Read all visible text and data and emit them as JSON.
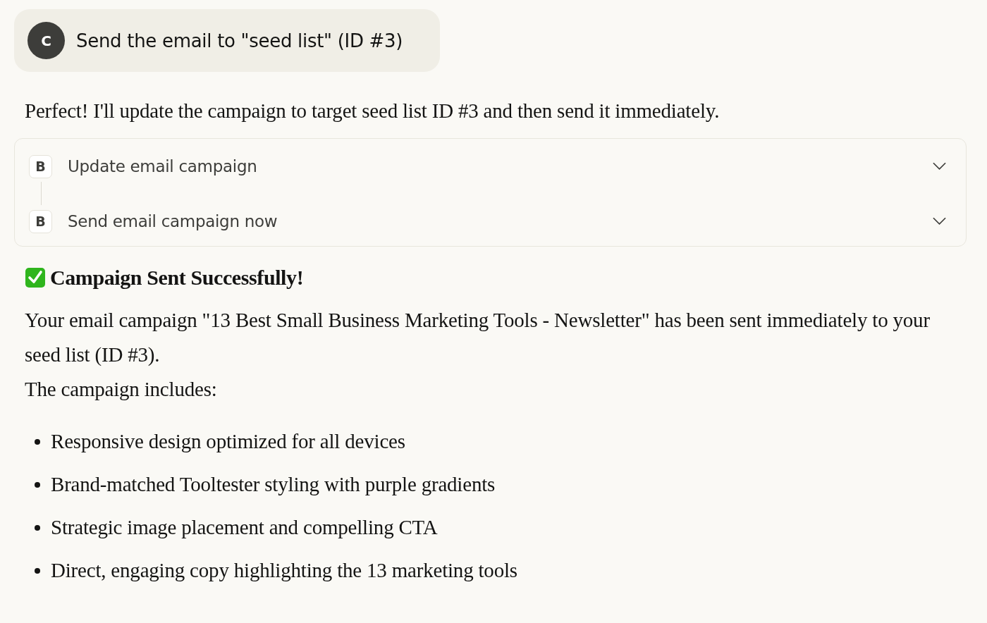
{
  "user_message": {
    "avatar": "C",
    "text": "Send the email to \"seed list\" (ID #3)"
  },
  "reply_intro": "Perfect! I'll update the campaign to target seed list ID #3 and then send it immediately.",
  "tool_calls": [
    {
      "badge": "B",
      "label": "Update email campaign",
      "expanded": false
    },
    {
      "badge": "B",
      "label": "Send email campaign now",
      "expanded": false
    }
  ],
  "heading": "Campaign Sent Successfully!",
  "paragraphs": [
    "Your email campaign \"13 Best Small Business Marketing Tools - Newsletter\" has been sent immediately to your seed list (ID #3).",
    "The campaign includes:"
  ],
  "bullets": [
    "Responsive design optimized for all devices",
    "Brand-matched Tooltester styling with purple gradients",
    "Strategic image placement and compelling CTA",
    "Direct, engaging copy highlighting the 13 marketing tools"
  ]
}
